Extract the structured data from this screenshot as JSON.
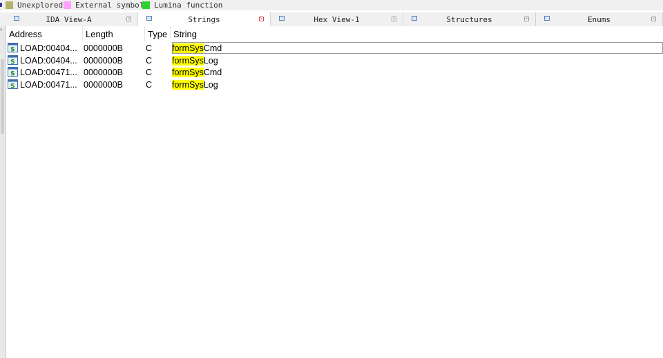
{
  "legend": [
    {
      "label": "Unexplored",
      "color": "#b5b36b"
    },
    {
      "label": "External symbol",
      "color": "#ff9fff"
    },
    {
      "label": "Lumina function",
      "color": "#2ed12e"
    }
  ],
  "tabs": [
    {
      "label": "IDA View-A",
      "active": false,
      "close": "×"
    },
    {
      "label": "Strings",
      "active": true,
      "close": "×"
    },
    {
      "label": "Hex View-1",
      "active": false,
      "close": "×"
    },
    {
      "label": "Structures",
      "active": false,
      "close": "×"
    },
    {
      "label": "Enums",
      "active": false,
      "close": "×"
    }
  ],
  "gutter": {
    "arrow": "‹"
  },
  "table": {
    "columns": [
      "Address",
      "Length",
      "Type",
      "String"
    ],
    "search_highlight": "formSys",
    "rows": [
      {
        "address": "LOAD:00404...",
        "length": "0000000B",
        "type": "C",
        "string_match": "formSys",
        "string_rest": "Cmd"
      },
      {
        "address": "LOAD:00404...",
        "length": "0000000B",
        "type": "C",
        "string_match": "formSys",
        "string_rest": "Log"
      },
      {
        "address": "LOAD:00471...",
        "length": "0000000B",
        "type": "C",
        "string_match": "formSys",
        "string_rest": "Cmd"
      },
      {
        "address": "LOAD:00471...",
        "length": "0000000B",
        "type": "C",
        "string_match": "formSys",
        "string_rest": "Log"
      }
    ]
  }
}
